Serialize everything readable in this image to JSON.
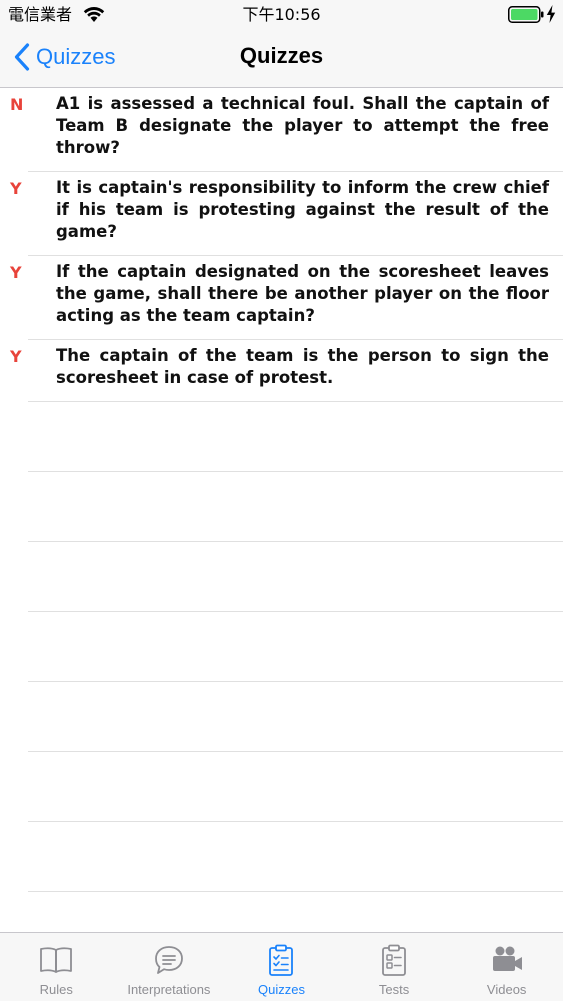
{
  "status_bar": {
    "carrier": "電信業者",
    "time": "下午10:56"
  },
  "nav": {
    "back_label": "Quizzes",
    "title": "Quizzes"
  },
  "colors": {
    "accent": "#1a82fb",
    "answer": "#e8433a",
    "battery": "#4cd964"
  },
  "quizzes": [
    {
      "answer": "N",
      "question": "A1 is assessed a technical foul. Shall the captain of Team B designate the player to attempt the free throw?"
    },
    {
      "answer": "Y",
      "question": "It is captain's responsibility to inform the crew chief if his team is protesting against the result of the game?"
    },
    {
      "answer": "Y",
      "question": "If the captain designated on the scoresheet leaves the game, shall there be another player on the floor acting as the team captain?"
    },
    {
      "answer": "Y",
      "question": "The captain of the team is the person to sign the scoresheet in case of protest."
    }
  ],
  "tabs": [
    {
      "label": "Rules",
      "icon": "book-icon"
    },
    {
      "label": "Interpretations",
      "icon": "speech-bubble-icon"
    },
    {
      "label": "Quizzes",
      "icon": "clipboard-check-icon"
    },
    {
      "label": "Tests",
      "icon": "clipboard-list-icon"
    },
    {
      "label": "Videos",
      "icon": "video-camera-icon"
    }
  ]
}
